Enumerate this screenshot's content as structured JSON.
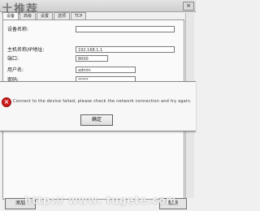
{
  "watermark": {
    "top": "土推荐",
    "bottom": "http:// www. tugete.com"
  },
  "window": {
    "close_glyph": "×"
  },
  "tabs": [
    "设备",
    "高级",
    "设置",
    "选项",
    "TCP"
  ],
  "form": {
    "fields": [
      {
        "label": "设备名称:",
        "value": ""
      },
      {
        "label": "主机名称/IP地址:",
        "value": "192.168.1.1"
      },
      {
        "label": "端口:",
        "value": "8000"
      },
      {
        "label": "用户名:",
        "value": "admin"
      },
      {
        "label": "密码:",
        "value": "*****"
      }
    ]
  },
  "dialog": {
    "message": "Connect to the device failed, please check the network connection and try again.",
    "ok_label": "确定"
  },
  "bottom_buttons": [
    "添加",
    "取消"
  ]
}
